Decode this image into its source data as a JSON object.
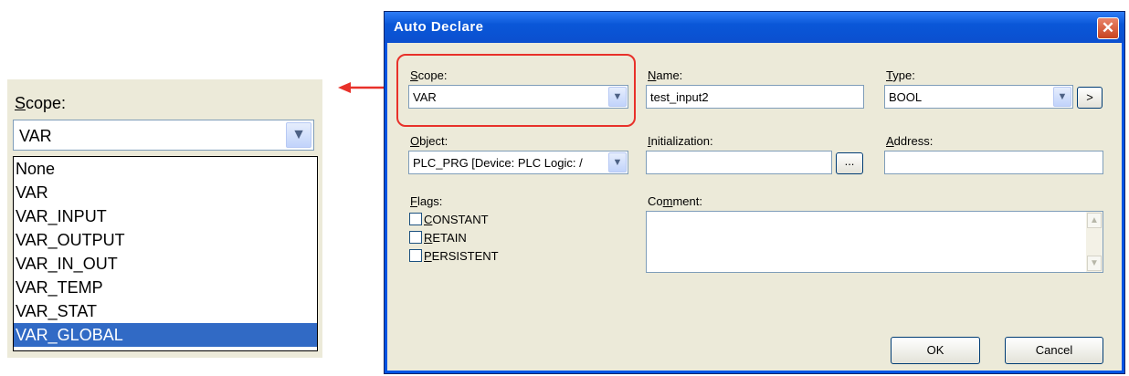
{
  "zoom": {
    "label_prefix": "S",
    "label_rest": "cope:",
    "selected_value": "VAR",
    "options": [
      "None",
      "VAR",
      "VAR_INPUT",
      "VAR_OUTPUT",
      "VAR_IN_OUT",
      "VAR_TEMP",
      "VAR_STAT",
      "VAR_GLOBAL"
    ],
    "highlighted_option": "VAR_GLOBAL"
  },
  "dialog": {
    "title": "Auto Declare",
    "scope": {
      "label_u": "S",
      "label_rest": "cope:",
      "value": "VAR"
    },
    "name": {
      "label_u": "N",
      "label_rest": "ame:",
      "value": "test_input2"
    },
    "type": {
      "label_u": "T",
      "label_rest": "ype:",
      "value": "BOOL",
      "button": ">"
    },
    "object": {
      "label_u": "O",
      "label_rest": "bject:",
      "value": "PLC_PRG [Device: PLC Logic: /"
    },
    "initialization": {
      "label_u": "I",
      "label_rest": "nitialization:",
      "value": "",
      "button": "..."
    },
    "address": {
      "label_u": "A",
      "label_rest": "ddress:",
      "value": ""
    },
    "flags": {
      "label_u": "F",
      "label_rest": "lags:",
      "items": [
        {
          "u": "C",
          "rest": "ONSTANT"
        },
        {
          "u": "R",
          "rest": "ETAIN"
        },
        {
          "u": "P",
          "rest": "ERSISTENT"
        }
      ]
    },
    "comment": {
      "label_pre": "Co",
      "label_u": "m",
      "label_rest": "ment:",
      "value": ""
    },
    "ok": "OK",
    "cancel": "Cancel"
  },
  "colors": {
    "highlight_outline": "#e8312a",
    "selection": "#316ac5",
    "titlebar": "#0a57d8"
  }
}
